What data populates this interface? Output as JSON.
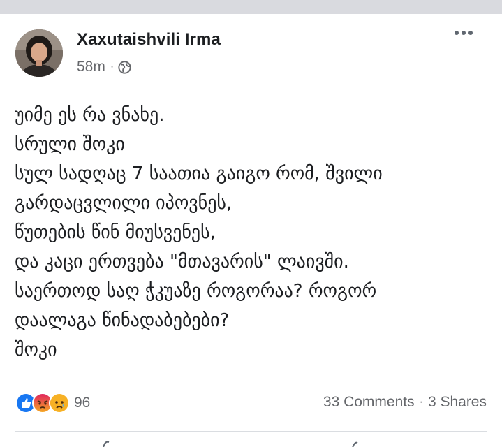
{
  "post": {
    "author": "Xaxutaishvili Irma",
    "time": "58m",
    "meta_separator": "·",
    "privacy_icon": "globe-icon",
    "more_icon": "more-options-icon",
    "lines": [
      "უიმე ეს რა ვნახე.",
      "სრული შოკი",
      "სულ სადღაც 7 საათია გაიგო რომ, შვილი",
      "გარდაცვლილი იპოვნეს,",
      "წუთების წინ მიუსვენეს,",
      "და კაცი ერთვება \"მთავარის\" ლაივში.",
      "საერთოდ საღ ჭკუაზე როგორაა? როგორ",
      "დაალაგა წინადაბებები?",
      "შოკი"
    ]
  },
  "reactions": {
    "icons": [
      "like-reaction-icon",
      "angry-reaction-icon",
      "sad-reaction-icon"
    ],
    "count": "96",
    "comments": "33 Comments",
    "separator": "·",
    "shares": "3 Shares"
  },
  "colors": {
    "like": "#1877f2",
    "angry": "#e9710f",
    "sad": "#f7b125",
    "secondary_text": "#65676b"
  }
}
